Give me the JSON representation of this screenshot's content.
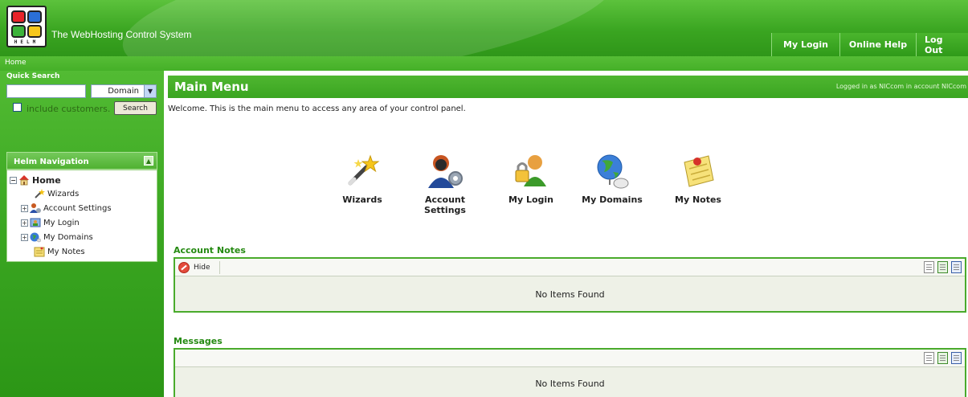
{
  "header": {
    "app_title": "The WebHosting Control System",
    "logo_text": "HELM",
    "nav": [
      "My Login",
      "Online Help",
      "Log Out"
    ]
  },
  "breadcrumb": "Home",
  "quick_search": {
    "title": "Quick Search",
    "input_value": "",
    "select_value": "Domain",
    "include_label": "include customers.",
    "search_button": "Search"
  },
  "helm_nav": {
    "title": "Helm Navigation",
    "items": [
      {
        "label": "Home",
        "icon": "home-icon"
      },
      {
        "label": "Wizards",
        "icon": "wizard-wand-icon"
      },
      {
        "label": "Account Settings",
        "icon": "account-settings-icon"
      },
      {
        "label": "My Login",
        "icon": "my-login-icon"
      },
      {
        "label": "My Domains",
        "icon": "globe-icon"
      },
      {
        "label": "My Notes",
        "icon": "notes-icon"
      }
    ]
  },
  "main": {
    "title": "Main Menu",
    "logged_in": "Logged in as NICcom in account NICcom",
    "welcome": "Welcome. This is the main menu to access any area of your control panel.",
    "tiles": [
      {
        "label": "Wizards",
        "icon": "wizard-wand-icon"
      },
      {
        "label": "Account Settings",
        "icon": "account-settings-icon"
      },
      {
        "label": "My Login",
        "icon": "my-login-icon"
      },
      {
        "label": "My Domains",
        "icon": "globe-icon"
      },
      {
        "label": "My Notes",
        "icon": "notes-icon"
      }
    ]
  },
  "account_notes": {
    "title": "Account Notes",
    "hide_label": "Hide",
    "empty": "No Items Found"
  },
  "messages": {
    "title": "Messages",
    "empty": "No Items Found"
  },
  "colors": {
    "brand_green": "#3aa521",
    "section_title_green": "#258a12"
  }
}
